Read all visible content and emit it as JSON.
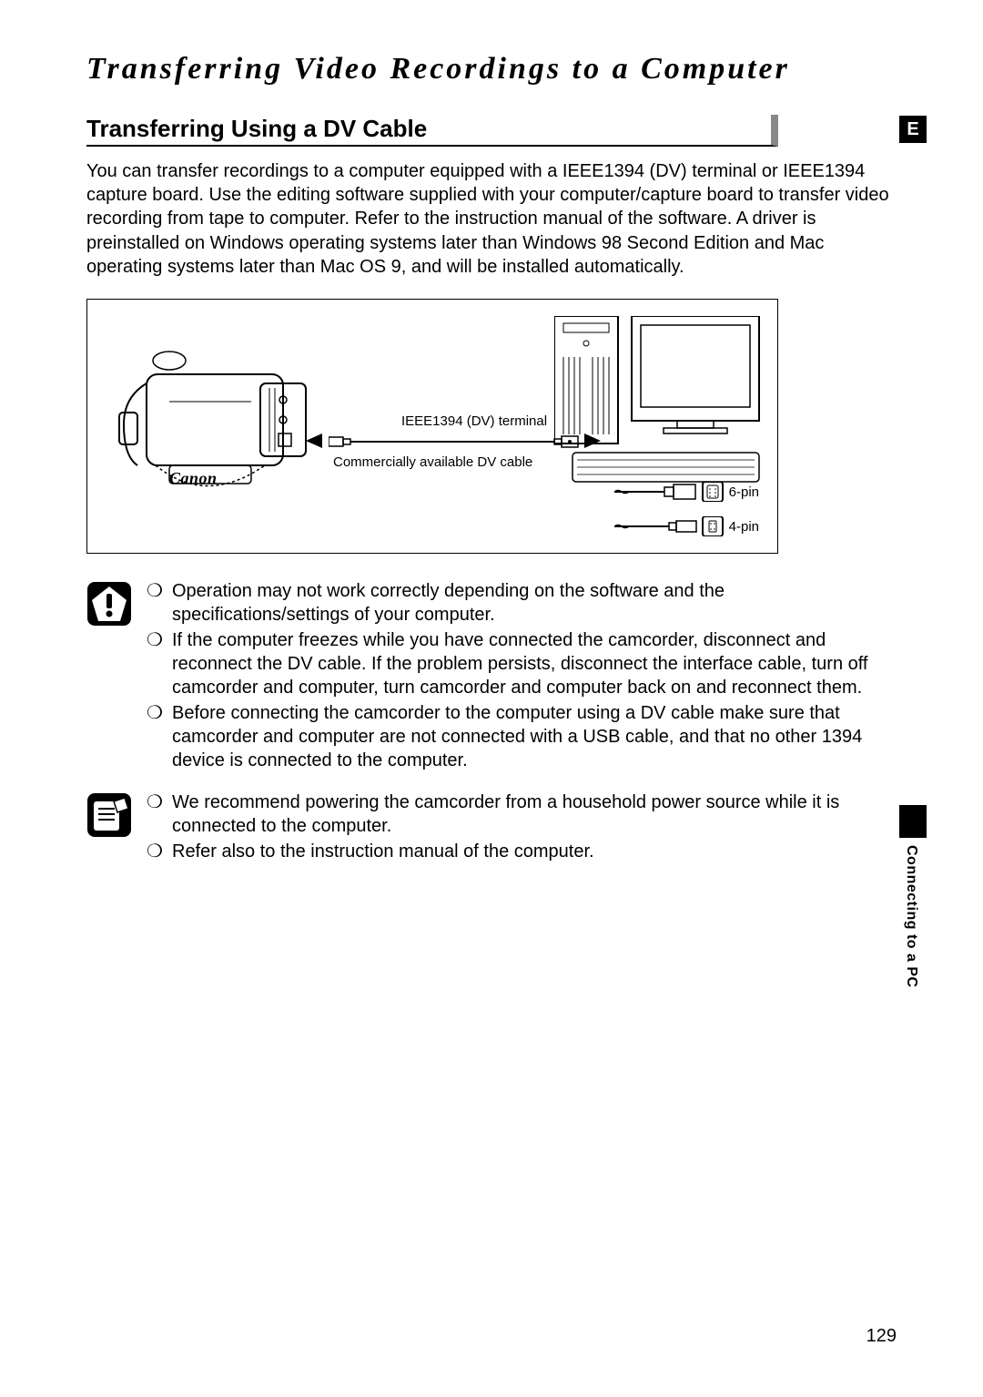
{
  "title": "Transferring Video Recordings to a Computer",
  "heading": "Transferring Using a DV Cable",
  "intro": "You can transfer recordings to a computer equipped with a IEEE1394 (DV) terminal or IEEE1394 capture board. Use the editing software supplied with your computer/capture board to transfer video recording from tape to computer. Refer to the instruction manual of the software. A driver is preinstalled on Windows operating systems later than Windows 98 Second Edition and Mac operating systems later than Mac OS 9, and will be installed automatically.",
  "diagram": {
    "brand": "Canon",
    "terminal_label": "IEEE1394 (DV) terminal",
    "cable_label": "Commercially available DV cable",
    "pin6": "6-pin",
    "pin4": "4-pin"
  },
  "caution_bullet": "❍",
  "caution_items": [
    "Operation may not work correctly depending on the software and the specifications/settings of your computer.",
    "If the computer freezes while you have connected the camcorder, disconnect and reconnect the DV cable. If the problem persists, disconnect the interface cable, turn off camcorder and computer, turn camcorder and computer back on and reconnect them.",
    "Before connecting the camcorder to the computer using a DV cable make sure that camcorder and computer are not connected with a USB cable, and that no other 1394 device is connected to the computer."
  ],
  "info_items": [
    "We recommend powering the camcorder from a household power source while it is connected to the computer.",
    "Refer also to the instruction manual of the computer."
  ],
  "side_tab": "E",
  "side_text": "Connecting to a PC",
  "page_number": "129"
}
